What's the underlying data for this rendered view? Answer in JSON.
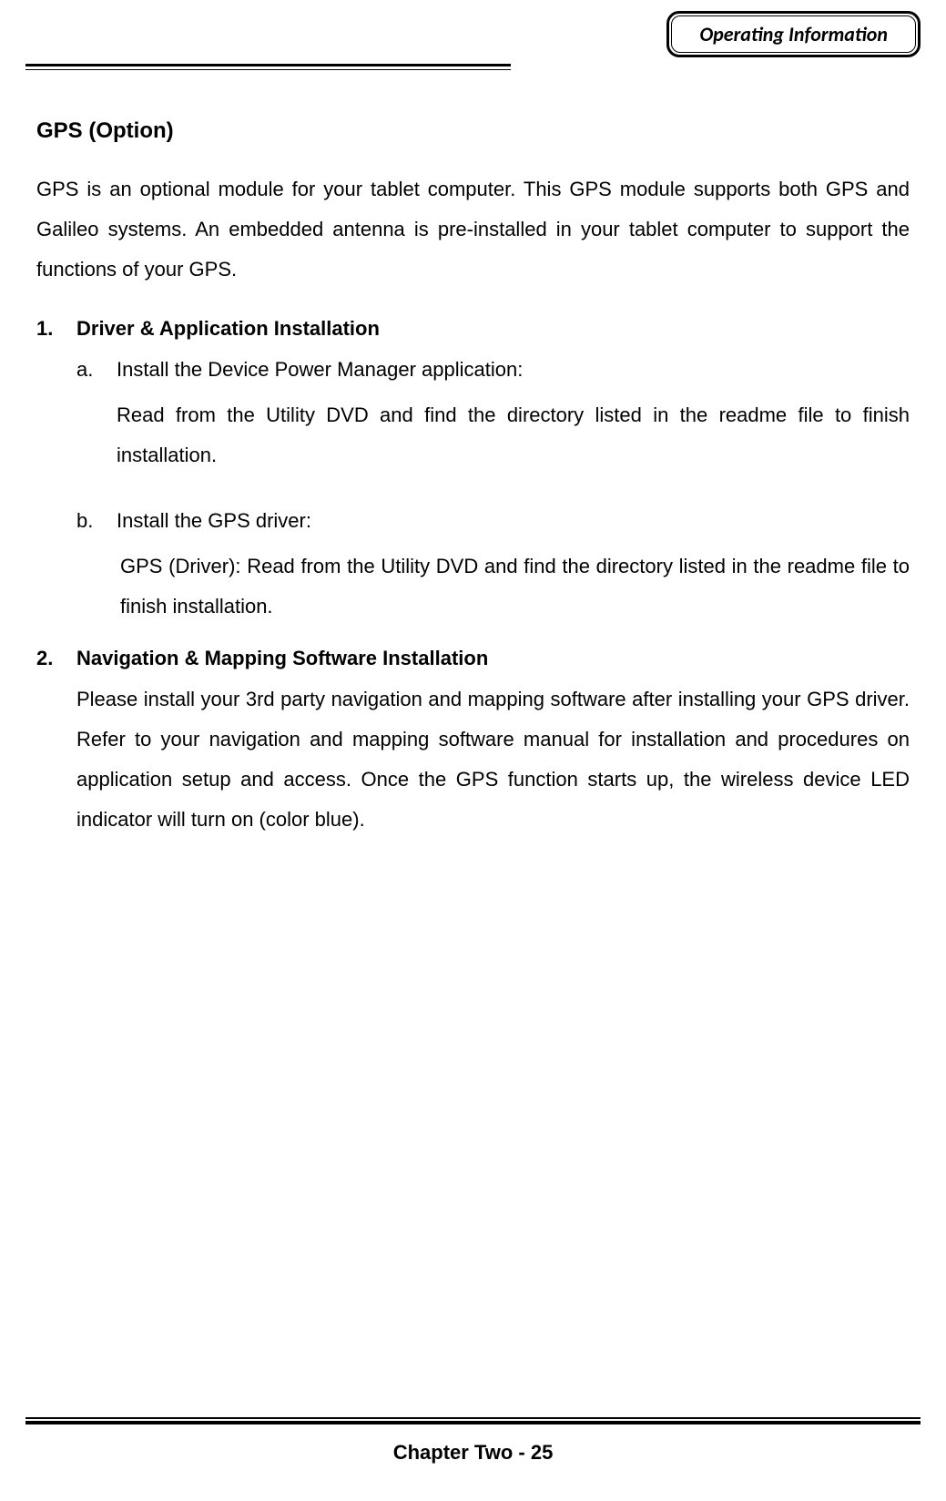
{
  "header": {
    "badge": "Operating Information"
  },
  "title": "GPS (Option)",
  "intro": "GPS is an optional module for your tablet computer. This GPS module supports both GPS and Galileo systems. An embedded antenna is pre-installed in your tablet computer to support the functions of your GPS.",
  "section1": {
    "num": "1.",
    "heading": "Driver & Application Installation",
    "a": {
      "letter": "a.",
      "line1": "Install the Device Power Manager application:",
      "body": "Read from the Utility DVD and find the directory listed in the readme file to finish installation."
    },
    "b": {
      "letter": "b.",
      "line1": "Install the GPS driver:",
      "body": "GPS (Driver): Read from the Utility DVD and find the directory listed in the readme file to finish installation."
    }
  },
  "section2": {
    "num": "2.",
    "heading": "Navigation & Mapping Software Installation",
    "body": "Please install your 3rd party navigation and mapping software after installing your GPS driver. Refer to your navigation and mapping software manual for installation and procedures on application setup and access. Once the GPS function starts up, the wireless device LED indicator will turn on (color blue)."
  },
  "footer": "Chapter Two - 25"
}
